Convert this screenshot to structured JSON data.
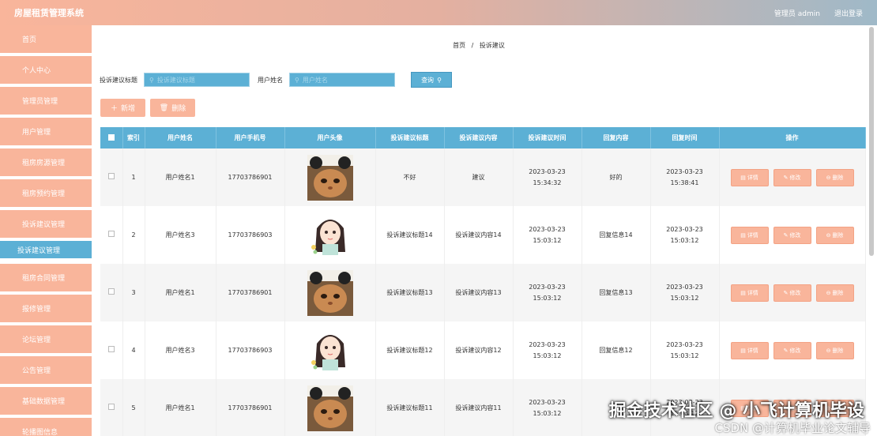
{
  "header": {
    "title": "房屋租赁管理系统",
    "user_label": "管理员 admin",
    "logout_label": "退出登录"
  },
  "sidebar": {
    "items": [
      {
        "label": "首页"
      },
      {
        "label": "个人中心"
      },
      {
        "label": "管理员管理"
      },
      {
        "label": "用户管理"
      },
      {
        "label": "租房房源管理"
      },
      {
        "label": "租房预约管理"
      },
      {
        "label": "投诉建议管理"
      },
      {
        "label": "投诉建议管理"
      },
      {
        "label": "租房合同管理"
      },
      {
        "label": "报修管理"
      },
      {
        "label": "论坛管理"
      },
      {
        "label": "公告管理"
      },
      {
        "label": "基础数据管理"
      },
      {
        "label": "轮播图信息"
      }
    ]
  },
  "breadcrumb": {
    "home": "首页",
    "sep": "/",
    "current": "投诉建议"
  },
  "search": {
    "title_label": "投诉建议标题",
    "title_placeholder": "投诉建议标题",
    "name_label": "用户姓名",
    "name_placeholder": "用户姓名",
    "button_label": "查询"
  },
  "actions": {
    "add_label": "新增",
    "delete_label": "删除"
  },
  "table": {
    "columns": [
      "索引",
      "用户姓名",
      "用户手机号",
      "用户头像",
      "投诉建议标题",
      "投诉建议内容",
      "投诉建议时间",
      "回复内容",
      "回复时间",
      "操作"
    ],
    "rows": [
      {
        "index": "1",
        "name": "用户姓名1",
        "phone": "17703786901",
        "avatar": "cat",
        "title": "不好",
        "content": "建议",
        "time": "2023-03-23 15:34:32",
        "reply": "好的",
        "reply_time": "2023-03-23 15:38:41"
      },
      {
        "index": "2",
        "name": "用户姓名3",
        "phone": "17703786903",
        "avatar": "girl",
        "title": "投诉建议标题14",
        "content": "投诉建议内容14",
        "time": "2023-03-23 15:03:12",
        "reply": "回复信息14",
        "reply_time": "2023-03-23 15:03:12"
      },
      {
        "index": "3",
        "name": "用户姓名1",
        "phone": "17703786901",
        "avatar": "cat",
        "title": "投诉建议标题13",
        "content": "投诉建议内容13",
        "time": "2023-03-23 15:03:12",
        "reply": "回复信息13",
        "reply_time": "2023-03-23 15:03:12"
      },
      {
        "index": "4",
        "name": "用户姓名3",
        "phone": "17703786903",
        "avatar": "girl",
        "title": "投诉建议标题12",
        "content": "投诉建议内容12",
        "time": "2023-03-23 15:03:12",
        "reply": "回复信息12",
        "reply_time": "2023-03-23 15:03:12"
      },
      {
        "index": "5",
        "name": "用户姓名1",
        "phone": "17703786901",
        "avatar": "cat",
        "title": "投诉建议标题11",
        "content": "投诉建议内容11",
        "time": "2023-03-23 15:03:12",
        "reply": "",
        "reply_time": "2023-03-23 15:03:12"
      }
    ],
    "row_actions": {
      "detail": "详情",
      "edit": "修改",
      "delete": "删除"
    }
  },
  "watermark": {
    "main": "掘金技术社区 @ 小飞计算机毕设",
    "sub": "CSDN @计算机毕业论文辅导"
  },
  "colors": {
    "primary": "#5cb0d5",
    "accent": "#f9b59b"
  }
}
